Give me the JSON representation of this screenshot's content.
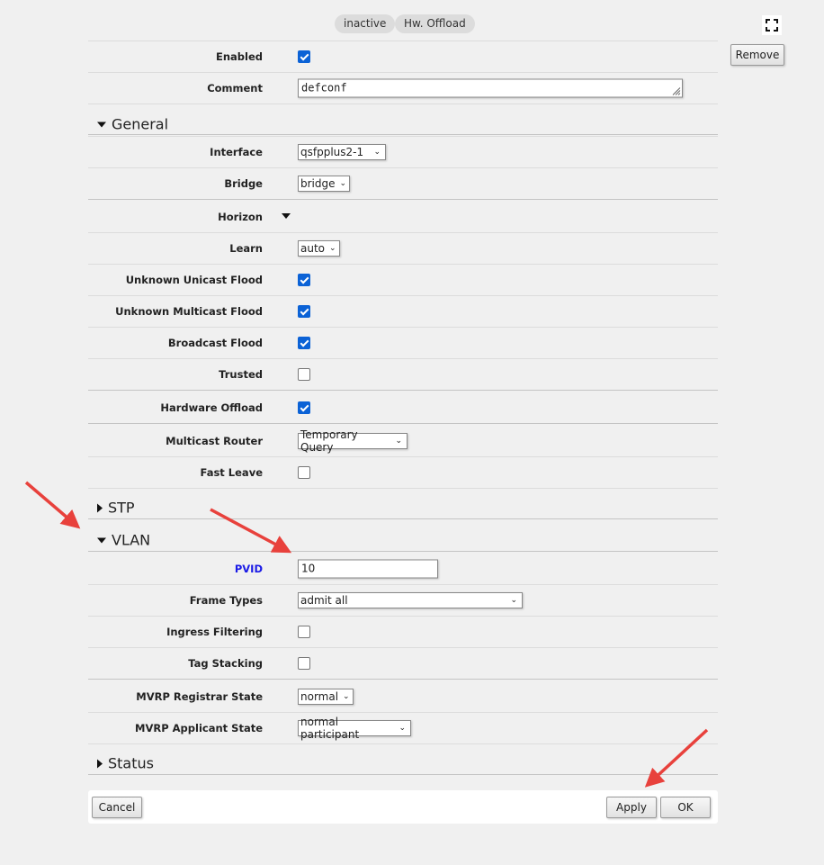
{
  "tags": [
    "inactive",
    "Hw. Offload"
  ],
  "remove_label": "Remove",
  "rows": [
    {
      "label": "Enabled",
      "type": "checkbox",
      "checked": true
    },
    {
      "label": "Comment",
      "type": "textarea",
      "value": "defconf"
    },
    {
      "section": "General",
      "expanded": true
    },
    {
      "label": "Interface",
      "type": "select",
      "value": "qsfpplus2-1"
    },
    {
      "label": "Bridge",
      "type": "select",
      "value": "bridge"
    },
    {
      "label": "Horizon",
      "type": "expander"
    },
    {
      "label": "Learn",
      "type": "select",
      "value": "auto"
    },
    {
      "label": "Unknown Unicast Flood",
      "type": "checkbox",
      "checked": true
    },
    {
      "label": "Unknown Multicast Flood",
      "type": "checkbox",
      "checked": true
    },
    {
      "label": "Broadcast Flood",
      "type": "checkbox",
      "checked": true
    },
    {
      "label": "Trusted",
      "type": "checkbox",
      "checked": false
    },
    {
      "label": "Hardware Offload",
      "type": "checkbox",
      "checked": true
    },
    {
      "label": "Multicast Router",
      "type": "select",
      "value": "Temporary Query"
    },
    {
      "label": "Fast Leave",
      "type": "checkbox",
      "checked": false
    },
    {
      "section": "STP",
      "expanded": false
    },
    {
      "section": "VLAN",
      "expanded": true
    },
    {
      "label": "PVID",
      "type": "input",
      "value": "10",
      "highlight": true
    },
    {
      "label": "Frame Types",
      "type": "select",
      "value": "admit all"
    },
    {
      "label": "Ingress Filtering",
      "type": "checkbox",
      "checked": false
    },
    {
      "label": "Tag Stacking",
      "type": "checkbox",
      "checked": false
    },
    {
      "label": "MVRP Registrar State",
      "type": "select",
      "value": "normal"
    },
    {
      "label": "MVRP Applicant State",
      "type": "select",
      "value": "normal participant"
    },
    {
      "section": "Status",
      "expanded": false
    }
  ],
  "footer": {
    "cancel": "Cancel",
    "apply": "Apply",
    "ok": "OK"
  },
  "colors": {
    "accent": "#0b62d6",
    "pvid_label": "#1a1ae6",
    "arrow": "#e8413c"
  }
}
